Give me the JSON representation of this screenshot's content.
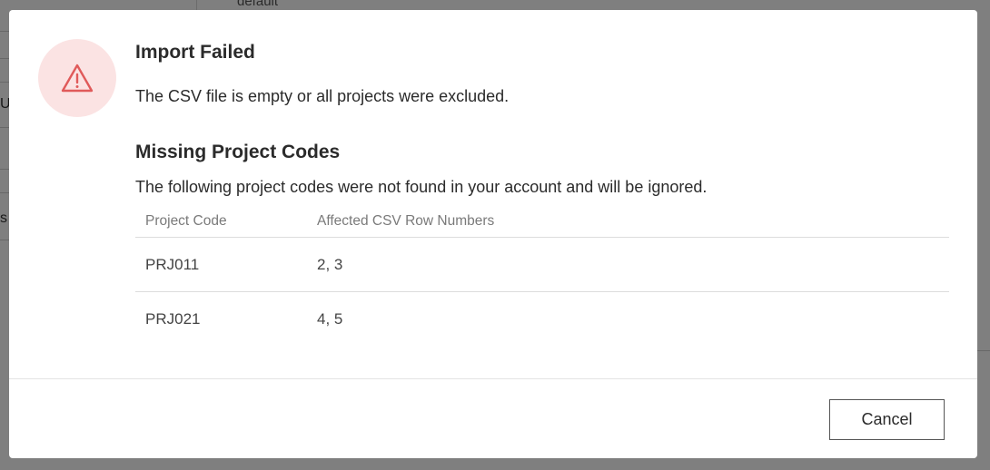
{
  "background": {
    "default_text": "default",
    "left_letters": [
      "U",
      "s"
    ]
  },
  "dialog": {
    "icon": "warning-triangle-icon",
    "accent_color": "#e05a5a",
    "icon_bg_color": "#fbe3e3",
    "title": "Import Failed",
    "message": "The CSV file is empty or all projects were excluded.",
    "section_title": "Missing Project Codes",
    "section_description": "The following project codes were not found in your account and will be ignored.",
    "table": {
      "headers": [
        "Project Code",
        "Affected CSV Row Numbers"
      ],
      "rows": [
        {
          "code": "PRJ011",
          "rows": "2, 3"
        },
        {
          "code": "PRJ021",
          "rows": "4, 5"
        }
      ]
    },
    "cancel_label": "Cancel"
  }
}
